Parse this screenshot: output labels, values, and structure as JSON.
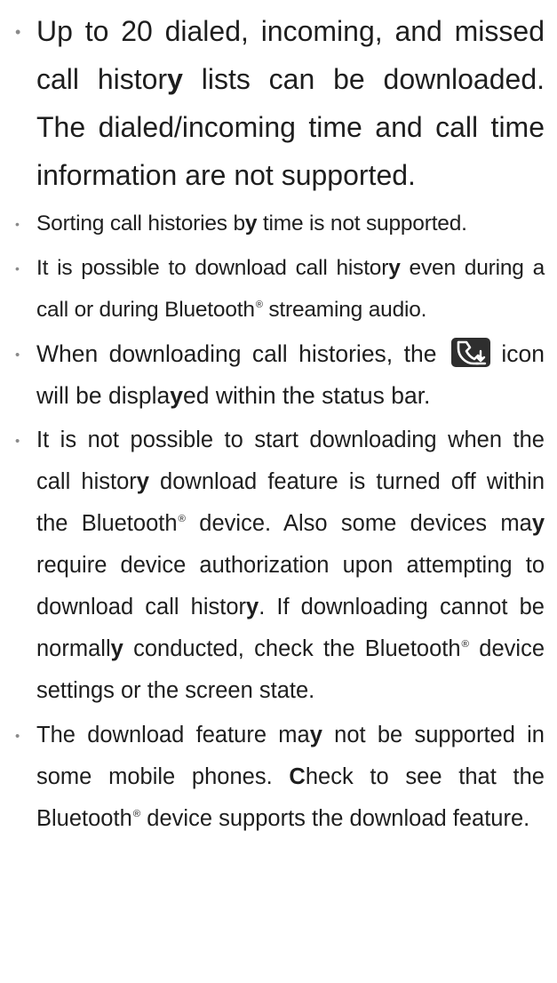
{
  "bullet_char": "•",
  "icons": {
    "download_status_icon": "call-history-download-icon"
  },
  "items": [
    {
      "text": "Up to 20 dialed, incoming, and missed call history lists can be downloaded. The dialed/incoming time and call time information are not supported."
    },
    {
      "text": "Sorting call histories by time is not supported."
    },
    {
      "text": "It is possible to download call history even during a call or during Bluetooth® streaming audio."
    },
    {
      "text_before_icon": "When downloading call histories, the",
      "text_after_icon": "icon will be displayed within the status bar."
    },
    {
      "text": "It is not possible to start downloading when the call history download feature is turned off within the Bluetooth® device. Also some devices may require device authorization upon attempting to download call history. If downloading cannot be normally conducted, check the Bluetooth® device settings or the screen state."
    },
    {
      "text": "The download feature may not be supported in some mobile phones. Check to see that the Bluetooth® device supports the download feature."
    }
  ]
}
